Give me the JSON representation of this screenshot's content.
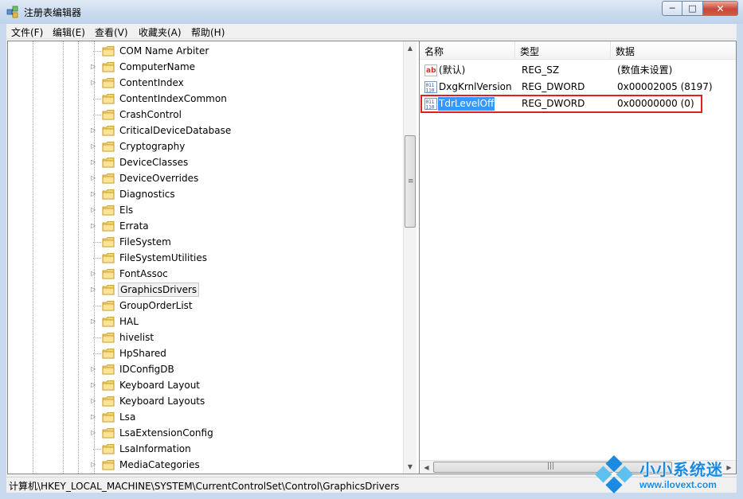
{
  "window": {
    "title": "注册表编辑器",
    "minimize": "─",
    "maximize": "□",
    "close": "✕"
  },
  "menu": [
    "文件(F)",
    "编辑(E)",
    "查看(V)",
    "收藏夹(A)",
    "帮助(H)"
  ],
  "tree": {
    "items": [
      {
        "label": "COM Name Arbiter",
        "expandable": false
      },
      {
        "label": "ComputerName",
        "expandable": true
      },
      {
        "label": "ContentIndex",
        "expandable": true
      },
      {
        "label": "ContentIndexCommon",
        "expandable": false
      },
      {
        "label": "CrashControl",
        "expandable": false
      },
      {
        "label": "CriticalDeviceDatabase",
        "expandable": true
      },
      {
        "label": "Cryptography",
        "expandable": true
      },
      {
        "label": "DeviceClasses",
        "expandable": true
      },
      {
        "label": "DeviceOverrides",
        "expandable": true
      },
      {
        "label": "Diagnostics",
        "expandable": true
      },
      {
        "label": "Els",
        "expandable": true
      },
      {
        "label": "Errata",
        "expandable": true
      },
      {
        "label": "FileSystem",
        "expandable": false
      },
      {
        "label": "FileSystemUtilities",
        "expandable": false
      },
      {
        "label": "FontAssoc",
        "expandable": true
      },
      {
        "label": "GraphicsDrivers",
        "expandable": true,
        "selected": true
      },
      {
        "label": "GroupOrderList",
        "expandable": false
      },
      {
        "label": "HAL",
        "expandable": true
      },
      {
        "label": "hivelist",
        "expandable": false
      },
      {
        "label": "HpShared",
        "expandable": false
      },
      {
        "label": "IDConfigDB",
        "expandable": true
      },
      {
        "label": "Keyboard Layout",
        "expandable": true
      },
      {
        "label": "Keyboard Layouts",
        "expandable": true
      },
      {
        "label": "Lsa",
        "expandable": true
      },
      {
        "label": "LsaExtensionConfig",
        "expandable": true
      },
      {
        "label": "LsaInformation",
        "expandable": false
      },
      {
        "label": "MediaCategories",
        "expandable": true
      },
      {
        "label": "",
        "expandable": true
      }
    ]
  },
  "list": {
    "columns": [
      "名称",
      "类型",
      "数据"
    ],
    "rows": [
      {
        "icon": "string-value-icon",
        "name": "(默认)",
        "type": "REG_SZ",
        "data": "(数值未设置)"
      },
      {
        "icon": "binary-value-icon",
        "name": "DxgKrnlVersion",
        "type": "REG_DWORD",
        "data": "0x00002005 (8197)"
      },
      {
        "icon": "binary-value-icon",
        "name": "TdrLevelOff",
        "type": "REG_DWORD",
        "data": "0x00000000 (0)",
        "selected": true
      }
    ]
  },
  "status": {
    "path": "计算机\\HKEY_LOCAL_MACHINE\\SYSTEM\\CurrentControlSet\\Control\\GraphicsDrivers"
  },
  "colors": {
    "selection": "#3399ff",
    "highlight_box": "#e02020",
    "watermark": "#1a8be0"
  },
  "watermark": {
    "title": "小小系统迷",
    "url": "www.ilovext.com"
  }
}
